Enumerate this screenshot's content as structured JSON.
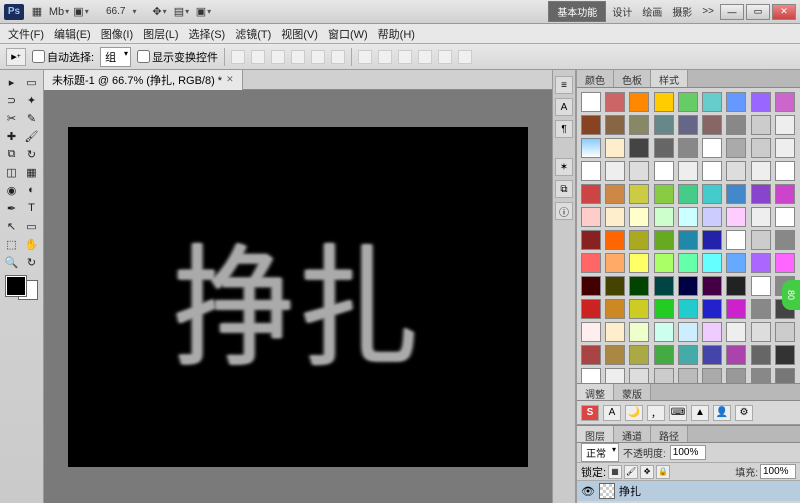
{
  "titlebar": {
    "app": "Ps",
    "zoom": "66.7",
    "workspaces": {
      "active": "基本功能",
      "others": [
        "设计",
        "绘画",
        "摄影"
      ]
    },
    "more": ">>"
  },
  "menu": {
    "file": "文件(F)",
    "edit": "编辑(E)",
    "image": "图像(I)",
    "layer": "图层(L)",
    "select": "选择(S)",
    "filter": "滤镜(T)",
    "view": "视图(V)",
    "window": "窗口(W)",
    "help": "帮助(H)"
  },
  "options": {
    "auto_select": "自动选择:",
    "group": "组",
    "show_transform": "显示变换控件"
  },
  "document": {
    "tab_title": "未标题-1 @ 66.7% (挣扎, RGB/8) *",
    "canvas_text": "挣扎"
  },
  "panels": {
    "color_tab": "颜色",
    "swatches_tab": "色板",
    "styles_tab": "样式",
    "adjustments_tab": "调整",
    "masks_tab": "蒙版",
    "layers_tab": "图层",
    "channels_tab": "通道",
    "paths_tab": "路径"
  },
  "layers": {
    "mode": "正常",
    "opacity_label": "不透明度:",
    "opacity": "100%",
    "lock_label": "锁定:",
    "fill_label": "填充:",
    "fill": "100%",
    "layer_name": "挣扎"
  },
  "ime": {
    "s": "S",
    "a": "A"
  },
  "badge": "80",
  "style_colors": [
    "#fff",
    "#c66",
    "#f80",
    "#fc0",
    "#6c6",
    "#6cc",
    "#69f",
    "#96f",
    "#c6c",
    "#842",
    "#864",
    "#886",
    "#688",
    "#668",
    "#866",
    "#888",
    "#ccc",
    "#eee",
    "linear-gradient(#8cf,#fff)",
    "#fec",
    "#444",
    "#666",
    "#888",
    "#fff",
    "#aaa",
    "#ccc",
    "#eee",
    "#fff",
    "#eee",
    "#ddd",
    "#fff",
    "#eee",
    "#fff",
    "#ddd",
    "#eee",
    "#fff",
    "#c44",
    "#c84",
    "#cc4",
    "#8c4",
    "#4c8",
    "#4cc",
    "#48c",
    "#84c",
    "#c4c",
    "#fcc",
    "#fec",
    "#ffc",
    "#cfc",
    "#cff",
    "#ccf",
    "#fcf",
    "#eee",
    "#fff",
    "#822",
    "#f60",
    "#aa2",
    "#6a2",
    "#28a",
    "#22a",
    "#fff",
    "#ccc",
    "#888",
    "#f66",
    "#fa6",
    "#ff6",
    "#af6",
    "#6fa",
    "#6ff",
    "#6af",
    "#a6f",
    "#f6f",
    "#400",
    "#440",
    "#040",
    "#044",
    "#004",
    "#404",
    "#222",
    "#fff",
    "#888",
    "#c22",
    "#c82",
    "#cc2",
    "#2c2",
    "#2cc",
    "#22c",
    "#c2c",
    "#888",
    "#444",
    "#fee",
    "#fec",
    "#efc",
    "#cfe",
    "#cef",
    "#ecf",
    "#eee",
    "#ddd",
    "#ccc",
    "#a44",
    "#a84",
    "#aa4",
    "#4a4",
    "#4aa",
    "#44a",
    "#a4a",
    "#666",
    "#333",
    "#fff",
    "#eee",
    "#ddd",
    "#ccc",
    "#bbb",
    "#aaa",
    "#999",
    "#888",
    "#777"
  ]
}
